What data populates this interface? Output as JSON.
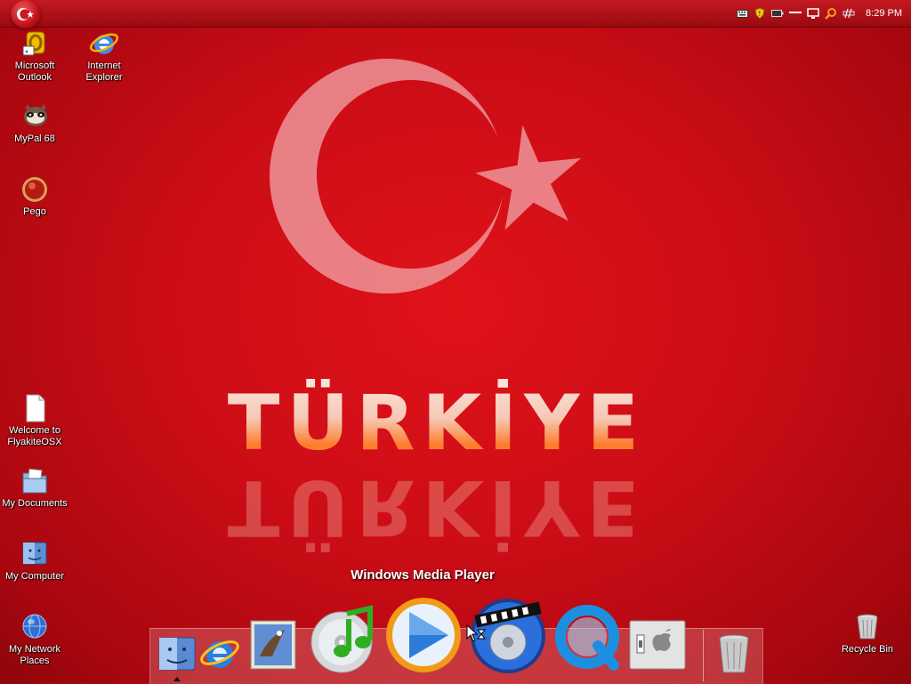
{
  "menubar": {
    "clock": "8:29 PM",
    "tray_icons": [
      "keyboard-icon",
      "shield-icon",
      "battery-icon",
      "minimize-line-icon",
      "monitor-icon",
      "search-icon",
      "network-icon"
    ]
  },
  "desktop": {
    "icons": [
      {
        "label": "Microsoft Outlook",
        "icon": "outlook-icon"
      },
      {
        "label": "Internet Explorer",
        "icon": "internet-explorer-icon"
      },
      {
        "label": "MyPal 68",
        "icon": "mypal-icon"
      },
      {
        "label": "Pego",
        "icon": "pego-icon"
      },
      {
        "label": "Welcome to FlyakiteOSX",
        "icon": "document-icon"
      },
      {
        "label": "My Documents",
        "icon": "folder-icon"
      },
      {
        "label": "My Computer",
        "icon": "finder-icon"
      },
      {
        "label": "My Network Places",
        "icon": "network-globe-icon"
      },
      {
        "label": "Recycle Bin",
        "icon": "trash-icon"
      }
    ]
  },
  "wallpaper": {
    "text": "TÜRKİYE"
  },
  "dock": {
    "hover_label": "Windows Media Player",
    "items": [
      {
        "icon": "finder-icon"
      },
      {
        "icon": "internet-explorer-icon"
      },
      {
        "icon": "mail-icon"
      },
      {
        "icon": "itunes-icon"
      },
      {
        "icon": "windows-media-player-icon"
      },
      {
        "icon": "dvd-player-icon"
      },
      {
        "icon": "quicktime-icon"
      },
      {
        "icon": "system-preferences-icon"
      },
      {
        "icon": "trash-icon"
      }
    ]
  },
  "colors": {
    "desktop_red": "#cc0d16",
    "menubar_red": "#b0121a"
  }
}
